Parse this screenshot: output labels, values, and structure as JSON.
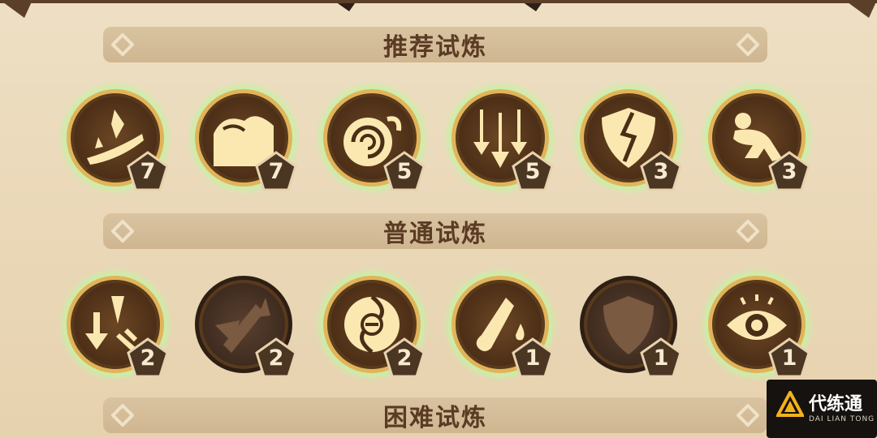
{
  "sections": [
    {
      "title": "推荐试炼",
      "trials": [
        {
          "icon": "slash-blade-icon",
          "level": "7",
          "locked": false
        },
        {
          "icon": "cloud-wing-icon",
          "level": "7",
          "locked": false
        },
        {
          "icon": "swirl-hand-icon",
          "level": "5",
          "locked": false
        },
        {
          "icon": "triple-arrow-down-icon",
          "level": "5",
          "locked": false
        },
        {
          "icon": "broken-shield-icon",
          "level": "3",
          "locked": false
        },
        {
          "icon": "crouching-figure-icon",
          "level": "3",
          "locked": false
        }
      ]
    },
    {
      "title": "普通试炼",
      "trials": [
        {
          "icon": "arrow-down-sword-icon",
          "level": "2",
          "locked": false
        },
        {
          "icon": "broken-arrow-icon",
          "level": "2",
          "locked": true
        },
        {
          "icon": "swirl-no-icon",
          "level": "2",
          "locked": false
        },
        {
          "icon": "potion-drop-icon",
          "level": "1",
          "locked": false
        },
        {
          "icon": "shield-icon",
          "level": "1",
          "locked": true
        },
        {
          "icon": "eye-icon",
          "level": "1",
          "locked": false
        }
      ]
    },
    {
      "title": "困难试炼",
      "trials": []
    }
  ],
  "watermark": {
    "title": "代练通",
    "subtitle": "DAI LIAN TONG"
  },
  "colors": {
    "glow": "#c8f0a6",
    "coin": "#4a2d16",
    "rim": "#e2b45a",
    "glyph": "#fbe8b0",
    "badge": "#4b3624",
    "header": "#d4bd98",
    "header_text": "#5a3b24"
  }
}
